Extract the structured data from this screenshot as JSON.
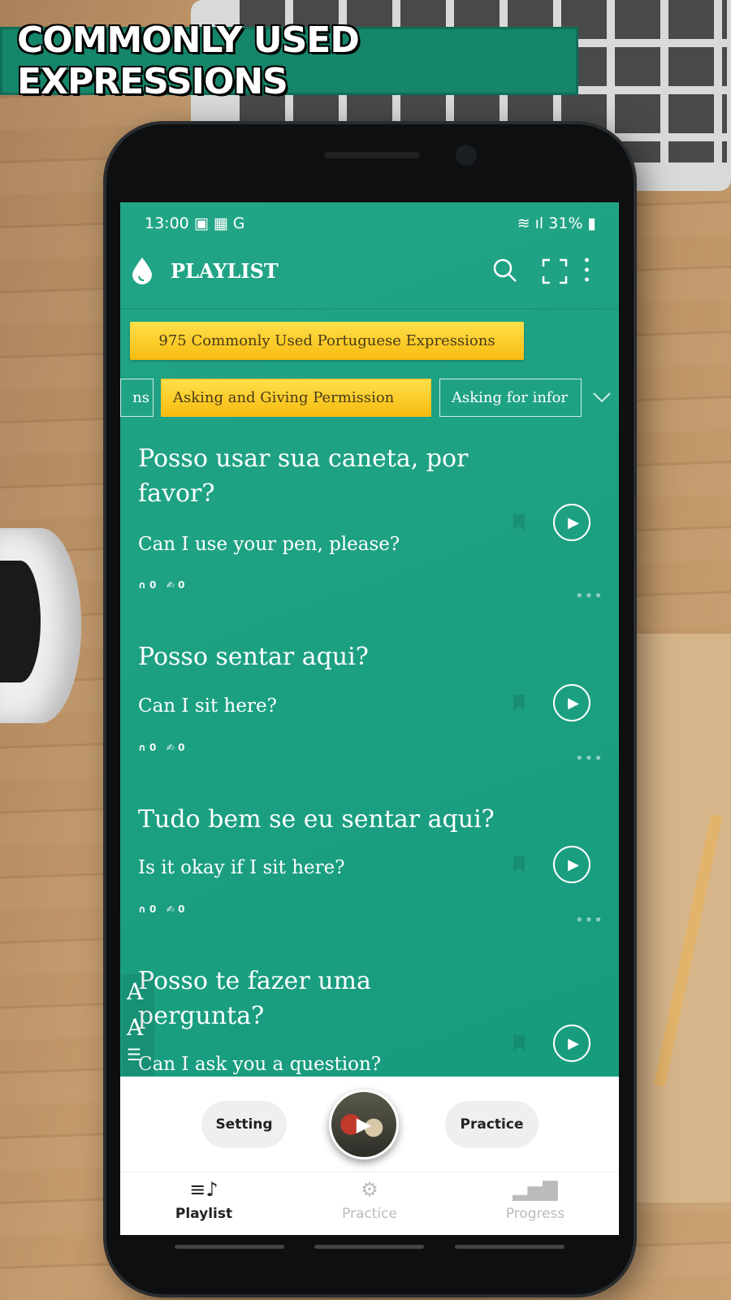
{
  "promo_title": "COMMONLY USED EXPRESSIONS",
  "status": {
    "time": "13:00",
    "battery": "31%"
  },
  "header": {
    "title": "PLAYLIST"
  },
  "playlist_banner": "975 Commonly Used Portuguese Expressions",
  "chips": [
    {
      "label": "ns"
    },
    {
      "label": "Asking and Giving Permission",
      "selected": true
    },
    {
      "label": "Asking for infor"
    }
  ],
  "items": [
    {
      "pt": "Posso usar sua caneta, por favor?",
      "en": "Can I use your pen, please?",
      "listens": "0",
      "practices": "0"
    },
    {
      "pt": "Posso sentar aqui?",
      "en": "Can I sit here?",
      "listens": "0",
      "practices": "0"
    },
    {
      "pt": "Tudo bem se eu sentar aqui?",
      "en": "Is it okay if I sit here?",
      "listens": "0",
      "practices": "0"
    },
    {
      "pt": "Posso te fazer uma pergunta?",
      "en": "Can I ask you a question?"
    }
  ],
  "side_tools": {
    "increase": "A",
    "decrease": "A"
  },
  "player": {
    "setting": "Setting",
    "practice": "Practice"
  },
  "bottom_nav": [
    {
      "label": "Playlist",
      "active": true
    },
    {
      "label": "Practice"
    },
    {
      "label": "Progress"
    }
  ],
  "colors": {
    "primary": "#1a9e80",
    "accent": "#f7bb10"
  }
}
